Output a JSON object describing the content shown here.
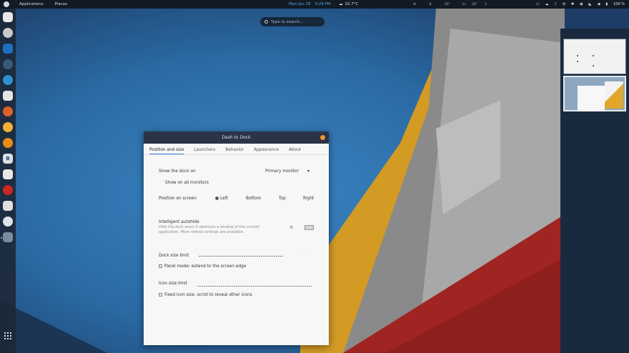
{
  "topbar": {
    "activities_label": "Applications",
    "places_label": "Places",
    "date": "Mon Jan 28",
    "time": "4:29 PM",
    "weather_temp": "32.7°C",
    "indicators": [
      "⚙",
      "⇅",
      "26°",
      "3↓",
      "26°",
      "3"
    ],
    "battery": "100 %"
  },
  "search": {
    "placeholder": "Type to search..."
  },
  "dialog": {
    "title": "Dash to Dock",
    "tabs": [
      "Position and size",
      "Launchers",
      "Behavior",
      "Appearance",
      "About"
    ],
    "show_dock_on_label": "Show the dock on",
    "monitor_value": "Primary monitor",
    "show_all_monitors_label": "Show on all monitors",
    "position_label": "Position on screen",
    "positions": [
      "Left",
      "Bottom",
      "Top",
      "Right"
    ],
    "autohide_title": "Intelligent autohide",
    "autohide_desc_1": "Hide the dock when it obstructs a window of the current",
    "autohide_desc_2": "application. More refined settings are available.",
    "dock_size_label": "Dock size limit",
    "panel_mode_label": "Panel mode: extend to the screen edge",
    "icon_size_label": "Icon size limit",
    "fixed_icon_label": "Fixed icon size: scroll to reveal other icons"
  },
  "colors": {
    "accent": "#3584e4",
    "close_button": "#f0952d",
    "wallpaper_blue": "#2f6ea6",
    "wallpaper_orange": "#d39a24",
    "wallpaper_red": "#a02522"
  }
}
